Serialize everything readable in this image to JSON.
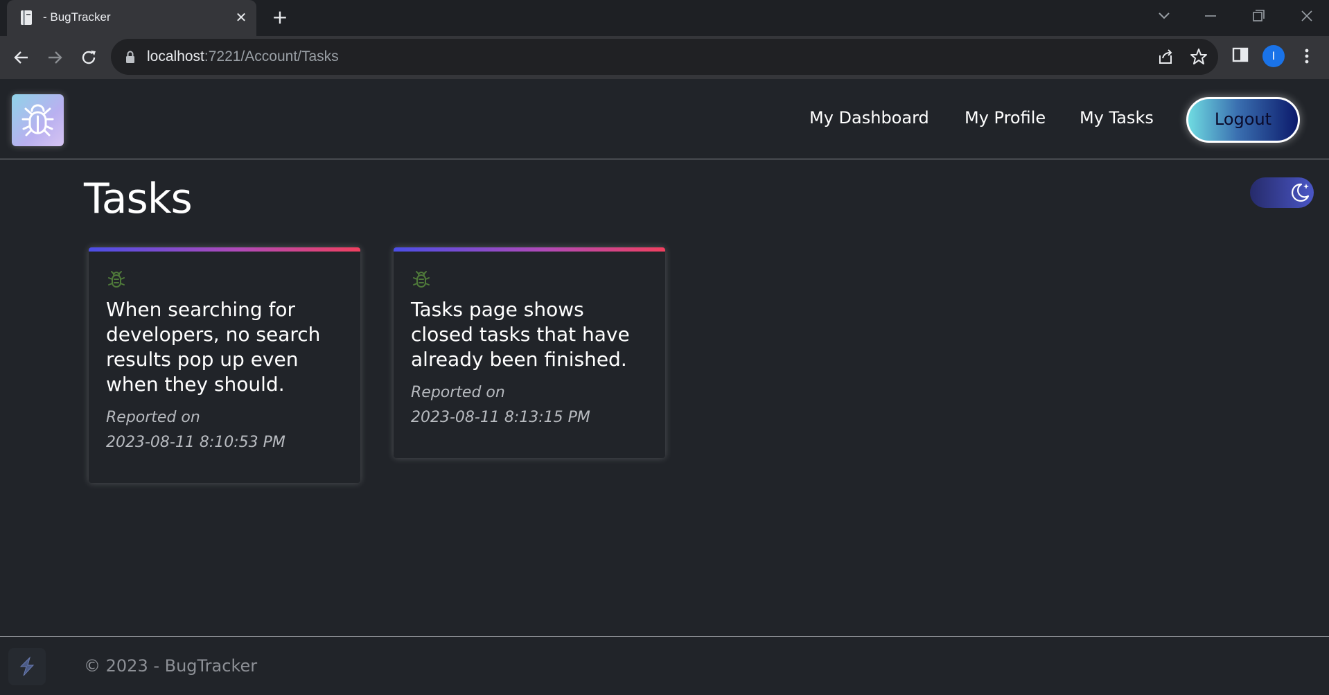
{
  "browser": {
    "tab_title": "- BugTracker",
    "url_host": "localhost",
    "url_rest": ":7221/Account/Tasks",
    "avatar_initial": "I"
  },
  "nav": {
    "links": [
      {
        "label": "My Dashboard"
      },
      {
        "label": "My Profile"
      },
      {
        "label": "My Tasks"
      }
    ],
    "logout_label": "Logout"
  },
  "page": {
    "title": "Tasks"
  },
  "tasks": [
    {
      "title": "When searching for developers, no search results pop up even when they should.",
      "reported_label": "Reported on",
      "reported_date": "2023-08-11 8:10:53 PM"
    },
    {
      "title": "Tasks page shows closed tasks that have already been finished.",
      "reported_label": "Reported on",
      "reported_date": "2023-08-11 8:13:15 PM"
    }
  ],
  "footer": {
    "text": "© 2023 - BugTracker"
  },
  "colors": {
    "background": "#212429",
    "card_bar_start": "#4b4ee6",
    "card_bar_end": "#f0405f",
    "bug_icon": "#4f7a3a"
  },
  "icons": [
    "tab-favicon-icon",
    "close-icon",
    "plus-icon",
    "back-arrow-icon",
    "forward-arrow-icon",
    "reload-icon",
    "lock-icon",
    "share-icon",
    "star-icon",
    "sidebar-icon",
    "kebab-menu-icon",
    "bug-logo-icon",
    "moon-icon",
    "bug-icon",
    "bolt-logo-icon"
  ]
}
